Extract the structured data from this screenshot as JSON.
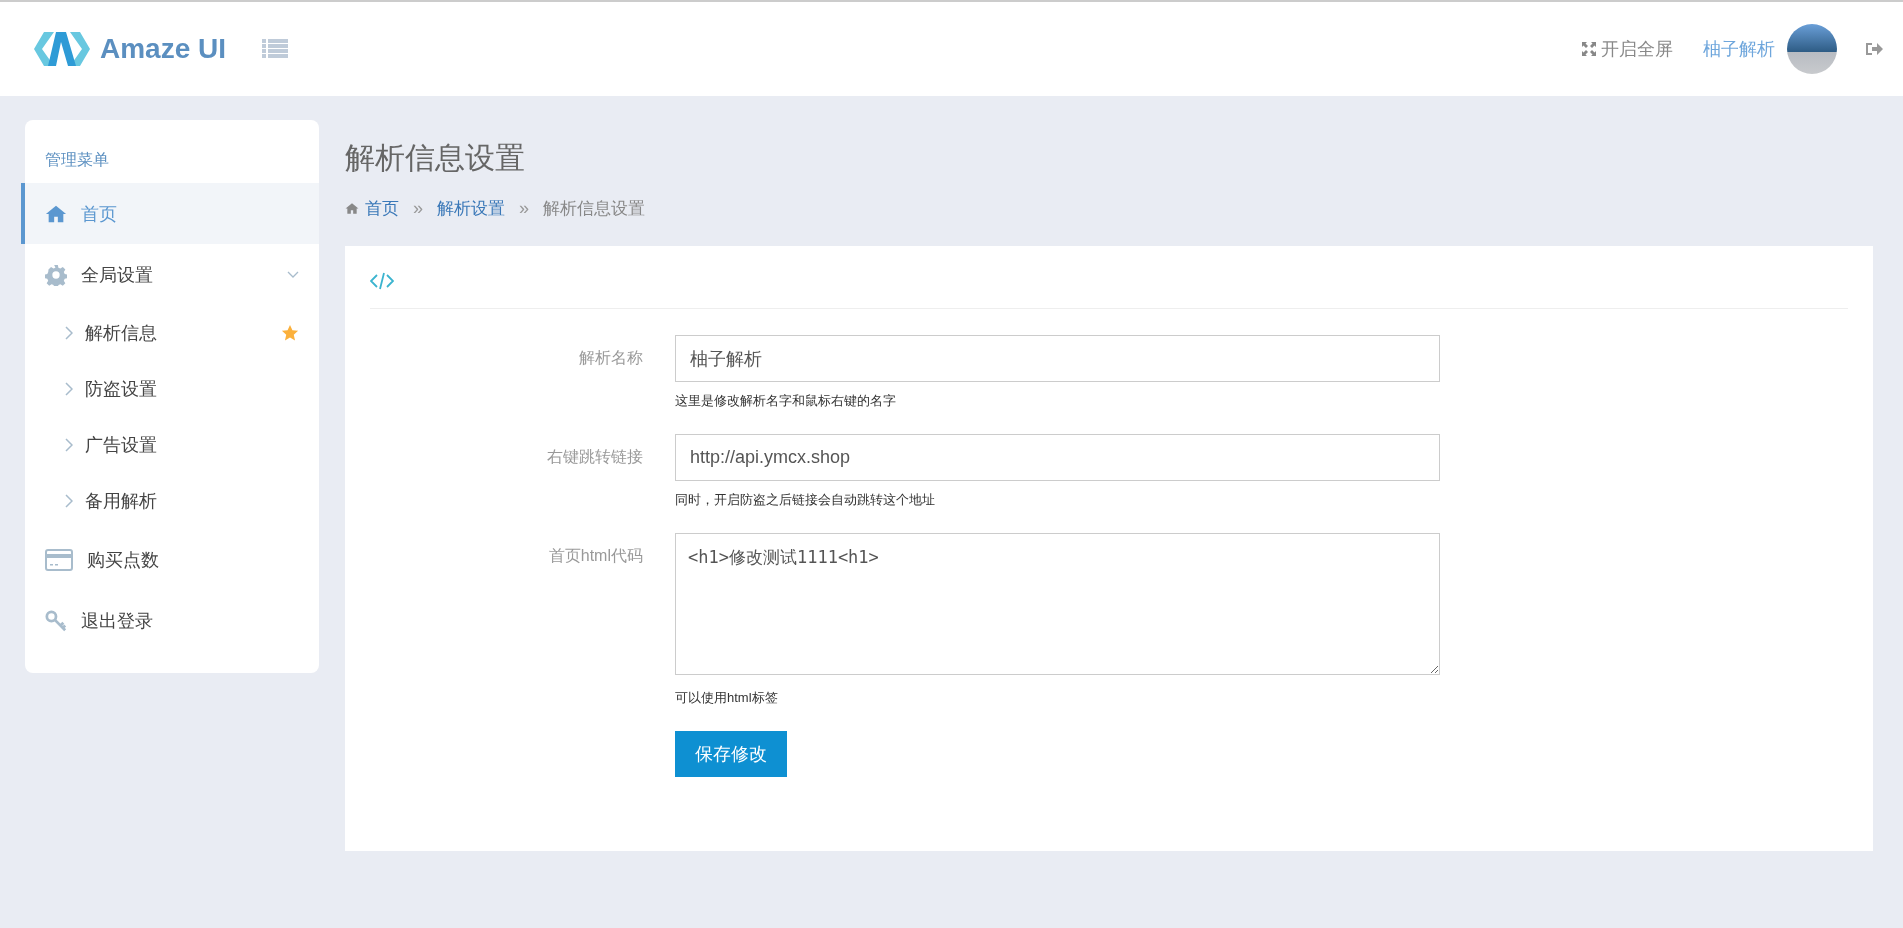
{
  "header": {
    "logo_text": "Amaze UI",
    "fullscreen_label": "开启全屏",
    "user_name": "柚子解析"
  },
  "sidebar": {
    "title": "管理菜单",
    "items": [
      {
        "label": "首页",
        "kind": "item",
        "selected": true
      },
      {
        "label": "全局设置",
        "kind": "group",
        "selected": false,
        "expanded": true,
        "children": [
          {
            "label": "解析信息",
            "starred": true,
            "selected": false
          },
          {
            "label": "防盗设置",
            "starred": false,
            "selected": false
          },
          {
            "label": "广告设置",
            "starred": false,
            "selected": false
          },
          {
            "label": "备用解析",
            "starred": false,
            "selected": false
          }
        ]
      },
      {
        "label": "购买点数",
        "kind": "item",
        "selected": false
      },
      {
        "label": "退出登录",
        "kind": "item",
        "selected": false
      }
    ]
  },
  "page_title": "解析信息设置",
  "breadcrumb": [
    {
      "label": "首页",
      "link": true
    },
    {
      "separator_before": "»",
      "label": "解析设置",
      "link": true
    },
    {
      "separator_before": "»",
      "label": "解析信息设置",
      "link": false
    }
  ],
  "form": {
    "fields": [
      {
        "label": "解析名称",
        "kind": "input",
        "value": "柚子解析",
        "help": "这里是修改解析名字和鼠标右键的名字"
      },
      {
        "label": "右键跳转链接",
        "kind": "input",
        "value": "http://api.ymcx.shop",
        "help": "同时，开启防盗之后链接会自动跳转这个地址"
      },
      {
        "label": "首页html代码",
        "kind": "textarea",
        "value": "<h1>修改测试1111<h1>",
        "help": "可以使用html标签"
      }
    ],
    "submit": "保存修改"
  }
}
